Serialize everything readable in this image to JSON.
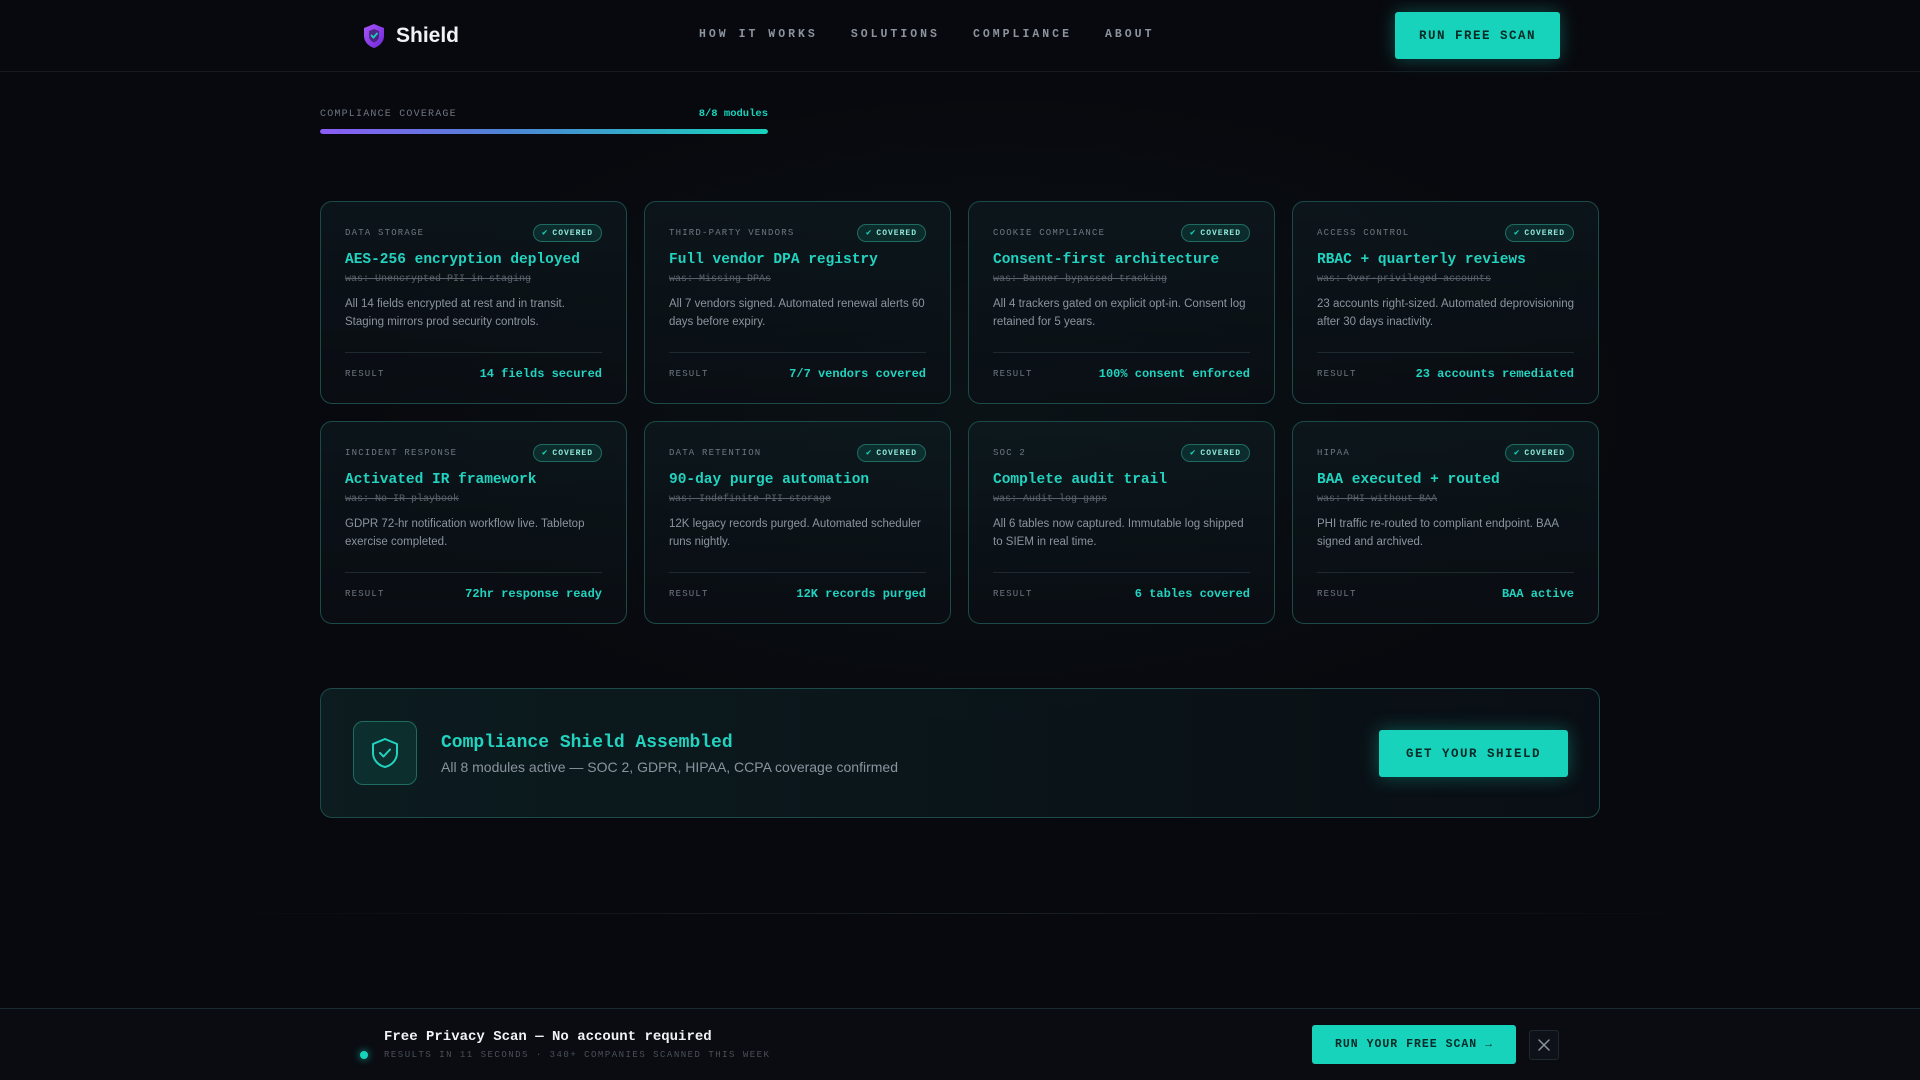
{
  "brand": {
    "name": "Shield"
  },
  "nav": {
    "items": [
      "HOW IT WORKS",
      "SOLUTIONS",
      "COMPLIANCE",
      "ABOUT"
    ],
    "cta_label": "RUN FREE SCAN"
  },
  "progress": {
    "label": "COMPLIANCE COVERAGE",
    "count_text": "8/8 modules",
    "fraction": 1.0
  },
  "cards": [
    {
      "category": "DATA STORAGE",
      "badge": "COVERED",
      "title": "AES-256 encryption deployed",
      "was": "was: Unencrypted PII in staging",
      "description": "All 14 fields encrypted at rest and in transit. Staging mirrors prod security controls.",
      "result_label": "RESULT",
      "result_value": "14 fields secured"
    },
    {
      "category": "THIRD-PARTY VENDORS",
      "badge": "COVERED",
      "title": "Full vendor DPA registry",
      "was": "was: Missing DPAs",
      "description": "All 7 vendors signed. Automated renewal alerts 60 days before expiry.",
      "result_label": "RESULT",
      "result_value": "7/7 vendors covered"
    },
    {
      "category": "COOKIE COMPLIANCE",
      "badge": "COVERED",
      "title": "Consent-first architecture",
      "was": "was: Banner bypassed tracking",
      "description": "All 4 trackers gated on explicit opt-in. Consent log retained for 5 years.",
      "result_label": "RESULT",
      "result_value": "100% consent enforced"
    },
    {
      "category": "ACCESS CONTROL",
      "badge": "COVERED",
      "title": "RBAC + quarterly reviews",
      "was": "was: Over-privileged accounts",
      "description": "23 accounts right-sized. Automated deprovisioning after 30 days inactivity.",
      "result_label": "RESULT",
      "result_value": "23 accounts remediated"
    },
    {
      "category": "INCIDENT RESPONSE",
      "badge": "COVERED",
      "title": "Activated IR framework",
      "was": "was: No IR playbook",
      "description": "GDPR 72-hr notification workflow live. Tabletop exercise completed.",
      "result_label": "RESULT",
      "result_value": "72hr response ready"
    },
    {
      "category": "DATA RETENTION",
      "badge": "COVERED",
      "title": "90-day purge automation",
      "was": "was: Indefinite PII storage",
      "description": "12K legacy records purged. Automated scheduler runs nightly.",
      "result_label": "RESULT",
      "result_value": "12K records purged"
    },
    {
      "category": "SOC 2",
      "badge": "COVERED",
      "title": "Complete audit trail",
      "was": "was: Audit log gaps",
      "description": "All 6 tables now captured. Immutable log shipped to SIEM in real time.",
      "result_label": "RESULT",
      "result_value": "6 tables covered"
    },
    {
      "category": "HIPAA",
      "badge": "COVERED",
      "title": "BAA executed + routed",
      "was": "was: PHI without BAA",
      "description": "PHI traffic re-routed to compliant endpoint. BAA signed and archived.",
      "result_label": "RESULT",
      "result_value": "BAA active"
    }
  ],
  "shield_banner": {
    "icon": "shield-check-icon",
    "title": "Compliance Shield Assembled",
    "subtitle": "All 8 modules active — SOC 2, GDPR, HIPAA, CCPA coverage confirmed",
    "cta_label": "GET YOUR SHIELD"
  },
  "bottom_bar": {
    "title": "Free Privacy Scan — No account required",
    "subtitle": "RESULTS IN 11 SECONDS · 340+ COMPANIES SCANNED THIS WEEK",
    "cta_label": "RUN YOUR FREE SCAN →",
    "close_icon": "close-icon"
  },
  "colors": {
    "accent": "#17d3bc",
    "background": "#08090e",
    "card_border": "#1b4a48",
    "logo_purple": "#8b5cf6"
  }
}
